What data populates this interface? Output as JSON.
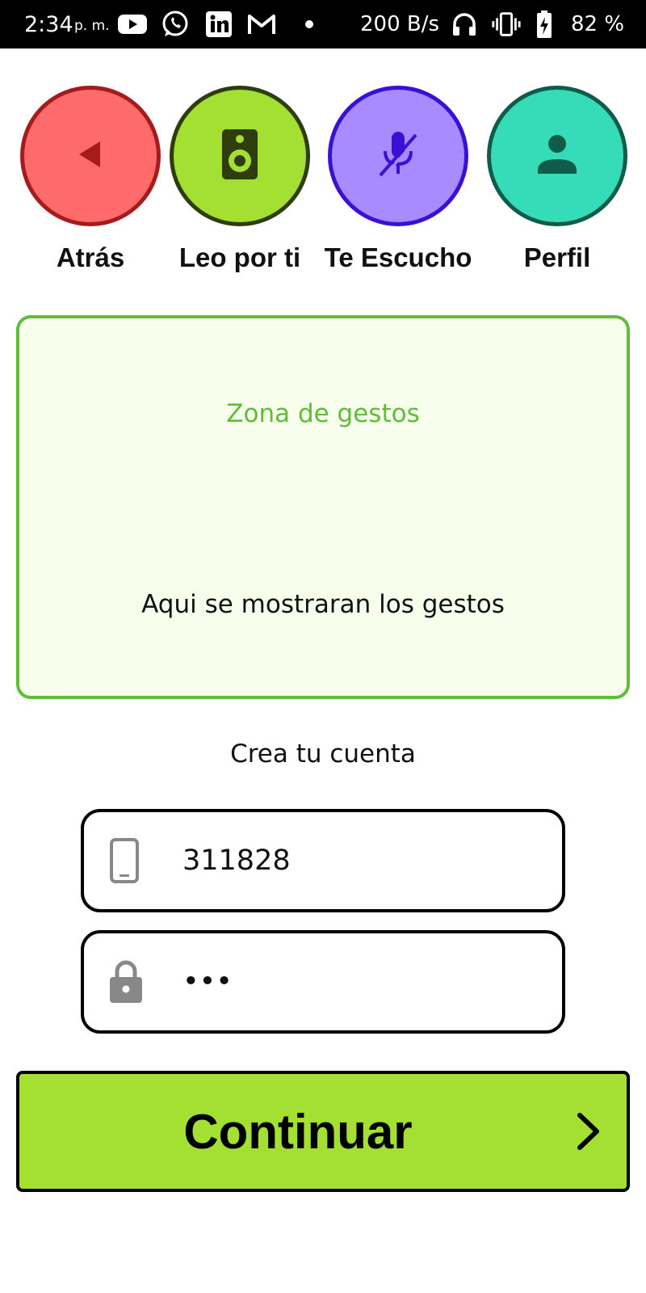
{
  "status_bar": {
    "time": "2:34",
    "ampm": "p. m.",
    "icons": [
      "youtube-icon",
      "whatsapp-icon",
      "linkedin-icon",
      "gmail-icon",
      "notification-dot",
      "headphones-icon",
      "vibrate-icon",
      "battery-charging-icon"
    ],
    "network_speed": "200 B/s",
    "battery": "82 %"
  },
  "nav": [
    {
      "label": "Atrás",
      "icon": "back-triangle-icon",
      "fill": "#ff6b6b",
      "border": "#a61b1b"
    },
    {
      "label": "Leo por ti",
      "icon": "speaker-icon",
      "fill": "#a3e032",
      "border": "#2f3d0c"
    },
    {
      "label": "Te Escucho",
      "icon": "mic-off-icon",
      "fill": "#a78bff",
      "border": "#3a10d6"
    },
    {
      "label": "Perfil",
      "icon": "person-icon",
      "fill": "#36dcb8",
      "border": "#0e5c4a"
    }
  ],
  "gesture_zone": {
    "title": "Zona de gestos",
    "subtitle": "Aqui se mostraran los gestos"
  },
  "form": {
    "heading": "Crea tu cuenta",
    "phone_value": "311828",
    "password_value": "•••"
  },
  "continue_button": {
    "label": "Continuar"
  },
  "colors": {
    "accent_green": "#a3e032",
    "gesture_border": "#5fbd3a",
    "gesture_bg": "#f8feec"
  }
}
